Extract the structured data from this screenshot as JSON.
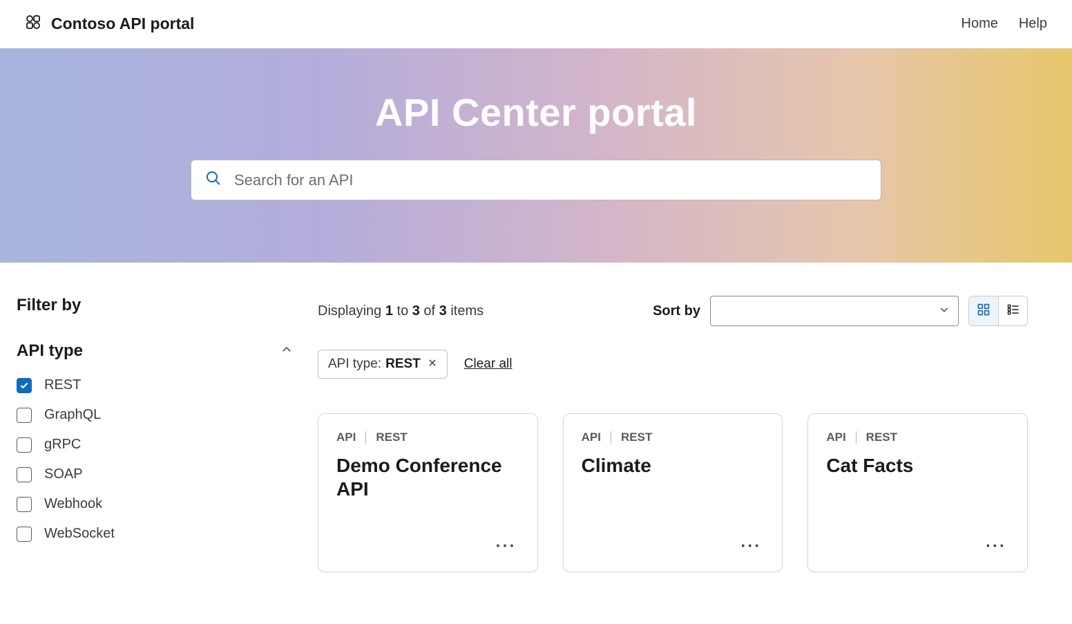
{
  "nav": {
    "brand": "Contoso API portal",
    "links": [
      "Home",
      "Help"
    ]
  },
  "hero": {
    "title": "API Center portal",
    "search_placeholder": "Search for an API"
  },
  "sidebar": {
    "filter_title": "Filter by",
    "facet_title": "API type",
    "facets": [
      {
        "label": "REST",
        "checked": true
      },
      {
        "label": "GraphQL",
        "checked": false
      },
      {
        "label": "gRPC",
        "checked": false
      },
      {
        "label": "SOAP",
        "checked": false
      },
      {
        "label": "Webhook",
        "checked": false
      },
      {
        "label": "WebSocket",
        "checked": false
      }
    ]
  },
  "toolbar": {
    "display_prefix": "Displaying ",
    "from": "1",
    "to_word": " to ",
    "to": "3",
    "of_word": " of ",
    "total": "3",
    "items_word": " items",
    "sort_label": "Sort by",
    "sort_value": ""
  },
  "chips": {
    "filter_chip_prefix": "API type: ",
    "filter_chip_value": "REST",
    "clear_all": "Clear all"
  },
  "cards": [
    {
      "tag1": "API",
      "tag2": "REST",
      "title": "Demo Conference API"
    },
    {
      "tag1": "API",
      "tag2": "REST",
      "title": "Climate"
    },
    {
      "tag1": "API",
      "tag2": "REST",
      "title": "Cat Facts"
    }
  ]
}
